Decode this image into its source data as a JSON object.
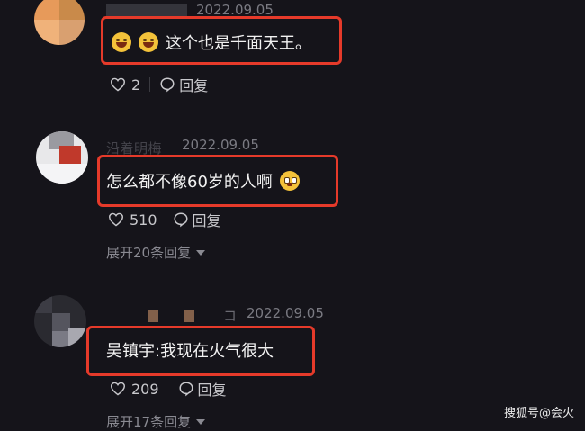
{
  "comments": [
    {
      "date": "2022.09.05",
      "text": "这个也是千面天王。",
      "likes": "2",
      "reply_label": "回复"
    },
    {
      "username": "沿着明梅",
      "date": "2022.09.05",
      "text": "怎么都不像60岁的人啊",
      "likes": "510",
      "reply_label": "回复",
      "expand_label": "展开20条回复"
    },
    {
      "username_tail": "コ",
      "date": "2022.09.05",
      "text": "吴镇宇:我现在火气很大",
      "likes": "209",
      "reply_label": "回复",
      "expand_label": "展开17条回复"
    }
  ],
  "watermark": "搜狐号@会火",
  "colors": {
    "highlight": "#e53a2a",
    "background": "#15141a"
  },
  "icons": [
    "heart-icon",
    "reply-icon",
    "caret-down-icon",
    "laughing-emoji-icon",
    "pleading-emoji-icon"
  ]
}
